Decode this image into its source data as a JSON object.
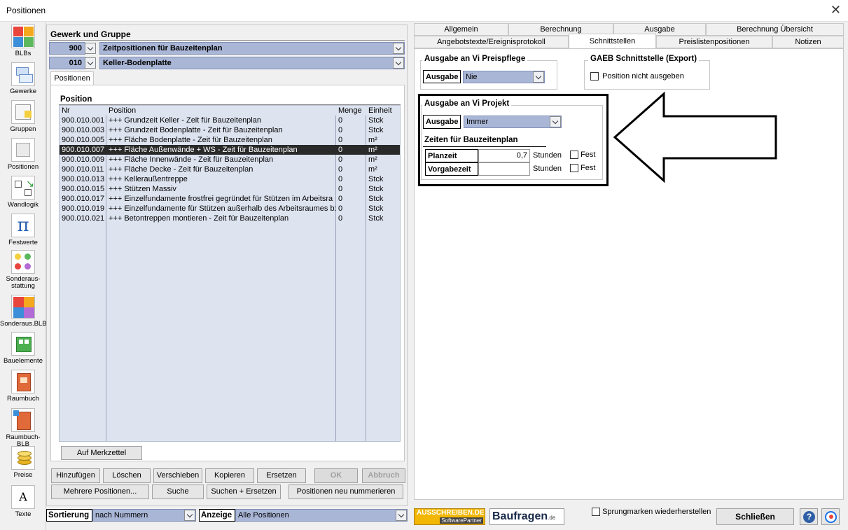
{
  "window": {
    "title": "Positionen"
  },
  "toolbar": [
    {
      "label": "BLBs"
    },
    {
      "label": "Gewerke"
    },
    {
      "label": "Gruppen"
    },
    {
      "label": "Positionen"
    },
    {
      "label": "Wandlogik"
    },
    {
      "label": "Festwerte"
    },
    {
      "label": "Sonderaus-\nstattung"
    },
    {
      "label": "Sonderaus.BLB"
    },
    {
      "label": "Bauelemente"
    },
    {
      "label": "Raumbuch"
    },
    {
      "label": "Raumbuch-BLB"
    },
    {
      "label": "Preise"
    },
    {
      "label": "Texte"
    }
  ],
  "gewerk": {
    "header": "Gewerk und Gruppe",
    "gewerk_nr": "900",
    "gewerk_name": "Zeitpositionen für Bauzeitenplan",
    "gruppe_nr": "010",
    "gruppe_name": "Keller-Bodenplatte"
  },
  "positions_tab": "Positionen",
  "position_table": {
    "header": "Position",
    "columns": [
      "Nr",
      "Position",
      "Menge",
      "Einheit"
    ],
    "rows": [
      {
        "nr": "900.010.001",
        "text": "+++ Grundzeit Keller - Zeit für Bauzeitenplan",
        "menge": "0",
        "einheit": "Stck"
      },
      {
        "nr": "900.010.003",
        "text": "+++ Grundzeit Bodenplatte - Zeit für Bauzeitenplan",
        "menge": "0",
        "einheit": "Stck"
      },
      {
        "nr": "900.010.005",
        "text": "+++ Fläche Bodenplatte  - Zeit für Bauzeitenplan",
        "menge": "0",
        "einheit": "m²"
      },
      {
        "nr": "900.010.007",
        "text": "+++ Fläche Außenwände + WS  - Zeit für Bauzeitenplan",
        "menge": "0",
        "einheit": "m²",
        "selected": true
      },
      {
        "nr": "900.010.009",
        "text": "+++ Fläche Innenwände  - Zeit für Bauzeitenplan",
        "menge": "0",
        "einheit": "m²"
      },
      {
        "nr": "900.010.011",
        "text": "+++ Fläche Decke  - Zeit für Bauzeitenplan",
        "menge": "0",
        "einheit": "m²"
      },
      {
        "nr": "900.010.013",
        "text": "+++ Kelleraußentreppe",
        "menge": "0",
        "einheit": "Stck"
      },
      {
        "nr": "900.010.015",
        "text": "+++ Stützen Massiv",
        "menge": "0",
        "einheit": "Stck"
      },
      {
        "nr": "900.010.017",
        "text": "+++ Einzelfundamente frostfrei gegründet für Stützen im Arbeitsra",
        "menge": "0",
        "einheit": "Stck"
      },
      {
        "nr": "900.010.019",
        "text": "+++ Einzelfundamente für Stützen außerhalb des Arbeitsraumes b:",
        "menge": "0",
        "einheit": "Stck"
      },
      {
        "nr": "900.010.021",
        "text": "+++ Betontreppen montieren - Zeit für Bauzeitenplan",
        "menge": "0",
        "einheit": "Stck"
      }
    ]
  },
  "buttons": {
    "merkzettel": "Auf Merkzettel",
    "hinzufuegen": "Hinzufügen",
    "loeschen": "Löschen",
    "verschieben": "Verschieben",
    "kopieren": "Kopieren",
    "ersetzen": "Ersetzen",
    "ok": "OK",
    "abbruch": "Abbruch",
    "mehrere": "Mehrere Positionen...",
    "suche": "Suche",
    "suchen_ersetzen": "Suchen + Ersetzen",
    "neu_nummerieren": "Positionen neu nummerieren",
    "schliessen": "Schließen"
  },
  "bottom": {
    "sortierung_label": "Sortierung",
    "sortierung_value": "nach Nummern",
    "anzeige_label": "Anzeige",
    "anzeige_value": "Alle Positionen",
    "sprungmarken": "Sprungmarken wiederherstellen",
    "logo1_top": "AUSSCHREIBEN.DE",
    "logo1_bottom": "SoftwarePartner",
    "logo2_main": "Baufragen",
    "logo2_suffix": ".de"
  },
  "tabs_row1": [
    "Allgemein",
    "Berechnung",
    "Ausgabe",
    "Berechnung Übersicht"
  ],
  "tabs_row2": [
    "Angebotstexte/Ereignisprotokoll",
    "Schnittstellen",
    "Preislistenpositionen",
    "Notizen"
  ],
  "schnittstellen": {
    "preispflege_title": "Ausgabe an Vi Preispflege",
    "preispflege_label": "Ausgabe",
    "preispflege_value": "Nie",
    "gaeb_title": "GAEB Schnittstelle (Export)",
    "gaeb_check": "Position nicht ausgeben",
    "projekt_title": "Ausgabe an Vi Projekt",
    "projekt_label": "Ausgabe",
    "projekt_value": "Immer",
    "zeiten_title": "Zeiten für Bauzeitenplan",
    "planzeit_label": "Planzeit",
    "planzeit_value": "0,7",
    "planzeit_unit": "Stunden",
    "planzeit_fest": "Fest",
    "vorgabe_label": "Vorgabezeit",
    "vorgabe_value": "",
    "vorgabe_unit": "Stunden",
    "vorgabe_fest": "Fest"
  }
}
